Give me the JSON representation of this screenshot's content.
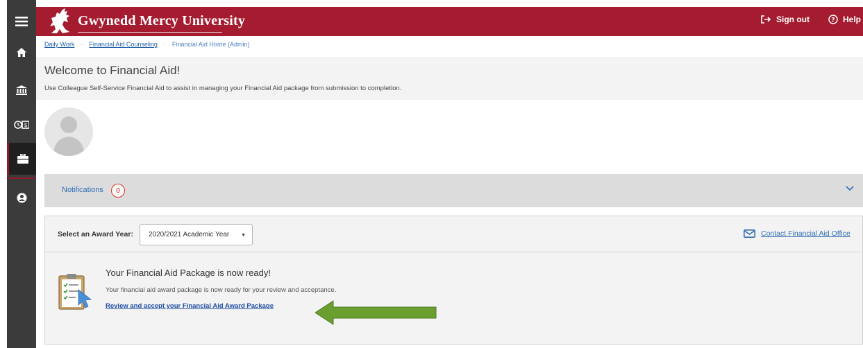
{
  "header": {
    "brand": "Gwynedd Mercy University",
    "sign_out": "Sign out",
    "help": "Help"
  },
  "sidebar": {
    "items": [
      {
        "icon": "menu-icon"
      },
      {
        "icon": "home-icon"
      },
      {
        "icon": "bank-icon"
      },
      {
        "icon": "time-money-icon"
      },
      {
        "icon": "briefcase-icon",
        "active": true
      },
      {
        "icon": "user-circle-icon"
      }
    ]
  },
  "breadcrumb": {
    "items": [
      "Daily Work",
      "Financial Aid Counseling",
      "Financial Aid Home (Admin)"
    ]
  },
  "welcome": {
    "title": "Welcome to Financial Aid!",
    "subtitle": "Use Colleague Self-Service Financial Aid to assist in managing your Financial Aid package from submission to completion."
  },
  "notifications": {
    "label": "Notifications",
    "count": "0"
  },
  "award_year": {
    "label": "Select an Award Year:",
    "selected": "2020/2021 Academic Year",
    "contact_link": "Contact Financial Aid Office"
  },
  "package": {
    "title": "Your Financial Aid Package is now ready!",
    "description": "Your financial aid award package is now ready for your review and acceptance.",
    "link": "Review and accept your Financial Aid Award Package"
  },
  "colors": {
    "header": "#a51c30",
    "sidebar": "#3b3b3b",
    "link": "#2f6db5",
    "arrow": "#6a9e2f"
  }
}
